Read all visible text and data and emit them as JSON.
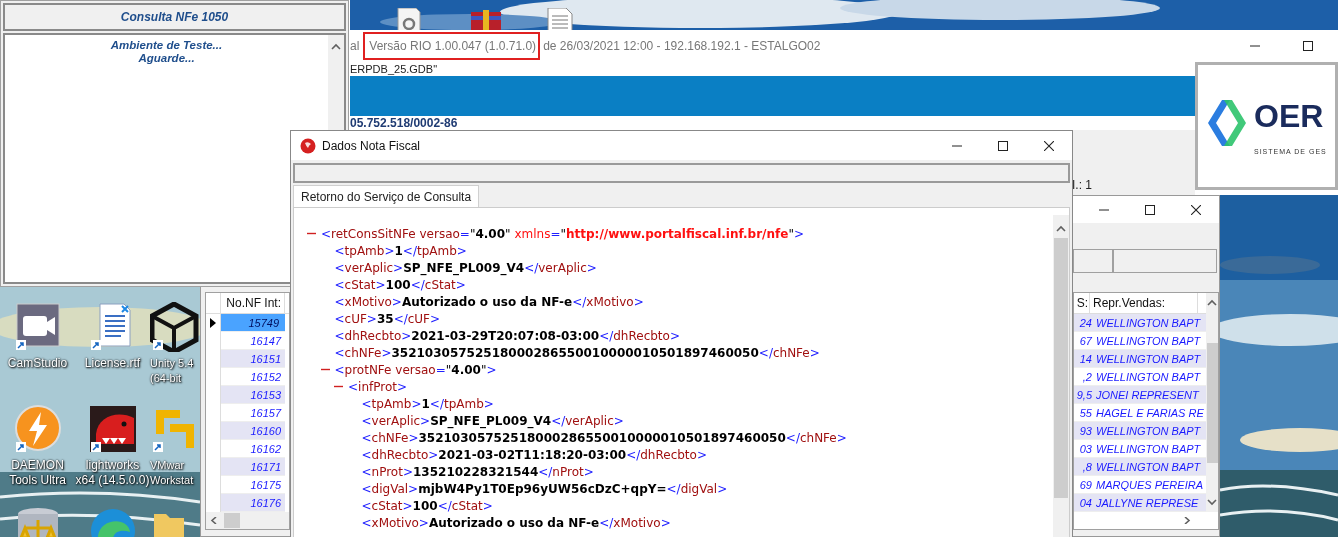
{
  "desktop": {
    "kind": "picture",
    "icons": [
      {
        "lines": [
          "CamStudio"
        ]
      },
      {
        "lines": [
          "License.rtf"
        ]
      },
      {
        "lines": [
          "Unity 5.4",
          "(64-bit"
        ]
      },
      {
        "lines": [
          "DAEMON",
          "Tools Ultra"
        ]
      },
      {
        "lines": [
          "lightworks",
          "x64 (14.5.0.0)"
        ]
      },
      {
        "lines": [
          "VMwar",
          "Workstat"
        ]
      }
    ]
  },
  "consulta_panel": {
    "title": "Consulta NFe 1050",
    "messages": [
      "Ambiente de Teste...",
      "Aguarde..."
    ]
  },
  "main_window": {
    "title_prefix": "al",
    "version": {
      "text": "Versão RIO 1.00.047 (1.0.71.0)",
      "highlighted": true
    },
    "title_rest": "de 26/03/2021 12:00 - 192.168.192.1 - ESTALGO02",
    "database": "ERPDB_25.GDB\"",
    "cnpj": "05.752.518/0002-86",
    "field_fragment": "I.: 1",
    "logo": {
      "text": "OER",
      "tagline": "SISTEMA DE GES"
    }
  },
  "list_window": {
    "columns": [
      "No.NF Int:",
      "S:",
      "Repr.Vendas:"
    ],
    "rows": [
      {
        "nf": "15749",
        "s": "24",
        "rep": "WELLINGTON BAPT",
        "selected": true
      },
      {
        "nf": "16147",
        "s": "67",
        "rep": "WELLINGTON BAPT",
        "selected": false
      },
      {
        "nf": "16151",
        "s": "14",
        "rep": "WELLINGTON BAPT",
        "selected": false
      },
      {
        "nf": "16152",
        "s": ",2",
        "rep": "WELLINGTON BAPT",
        "selected": false
      },
      {
        "nf": "16153",
        "s": "9,5",
        "rep": "JONEI REPRESENT",
        "selected": false
      },
      {
        "nf": "16157",
        "s": "55",
        "rep": "HAGEL E FARIAS RE",
        "selected": false
      },
      {
        "nf": "16160",
        "s": "93",
        "rep": "WELLINGTON BAPT",
        "selected": false
      },
      {
        "nf": "16162",
        "s": "03",
        "rep": "WELLINGTON BAPT",
        "selected": false
      },
      {
        "nf": "16171",
        "s": ",8",
        "rep": "WELLINGTON BAPT",
        "selected": false
      },
      {
        "nf": "16175",
        "s": "69",
        "rep": "MARQUES PEREIRA",
        "selected": false
      },
      {
        "nf": "16176",
        "s": "04",
        "rep": "JALLYNE REPRESE",
        "selected": false
      }
    ]
  },
  "dialog": {
    "title": "Dados Nota Fiscal",
    "tabs": [
      {
        "label": "Retorno do Serviço de Consulta",
        "selected": true
      }
    ],
    "xml": [
      {
        "tag_open": "<retConsSitNFe",
        "attributes": [
          {
            "kind": "attribute",
            "name": " versao=",
            "value": "\"4.00\""
          },
          {
            "kind": "namespace",
            "name": " xmlns=",
            "value": "\"http://www.portalfiscal.inf.br/nfe\""
          }
        ],
        "tag_end": ">",
        "expanded": true,
        "children": [
          {
            "tag_open": "<tpAmb>",
            "value": "1",
            "tag_close": "</tpAmb>"
          },
          {
            "tag_open": "<verAplic>",
            "value": "SP_NFE_PL009_V4",
            "tag_close": "</verAplic>"
          },
          {
            "tag_open": "<cStat>",
            "value": "100",
            "tag_close": "</cStat>"
          },
          {
            "tag_open": "<xMotivo>",
            "value": "Autorizado o uso da NF-e",
            "tag_close": "</xMotivo>"
          },
          {
            "tag_open": "<cUF>",
            "value": "35",
            "tag_close": "</cUF>"
          },
          {
            "tag_open": "<dhRecbto>",
            "value": "2021-03-29T20:07:08-03:00",
            "tag_close": "</dhRecbto>"
          },
          {
            "tag_open": "<chNFe>",
            "value": "35210305752518000286550010000010501897460050",
            "tag_close": "</chNFe>"
          },
          {
            "tag_open": "<protNFe",
            "attributes": [
              {
                "kind": "attribute",
                "name": " versao=",
                "value": "\"4.00\""
              }
            ],
            "tag_end": ">",
            "expanded": true,
            "children": [
              {
                "tag_open": "<infProt>",
                "expanded": true,
                "children": [
                  {
                    "tag_open": "<tpAmb>",
                    "value": "1",
                    "tag_close": "</tpAmb>"
                  },
                  {
                    "tag_open": "<verAplic>",
                    "value": "SP_NFE_PL009_V4",
                    "tag_close": "</verAplic>"
                  },
                  {
                    "tag_open": "<chNFe>",
                    "value": "35210305752518000286550010000010501897460050",
                    "tag_close": "</chNFe>"
                  },
                  {
                    "tag_open": "<dhRecbto>",
                    "value": "2021-03-02T11:18:20-03:00",
                    "tag_close": "</dhRecbto>"
                  },
                  {
                    "tag_open": "<nProt>",
                    "value": "135210228321544",
                    "tag_close": "</nProt>"
                  },
                  {
                    "tag_open": "<digVal>",
                    "value": "mjbW4Py1T0Ep96yUW56cDzC+qpY=",
                    "tag_close": "</digVal>"
                  },
                  {
                    "tag_open": "<cStat>",
                    "value": "100",
                    "tag_close": "</cStat>"
                  },
                  {
                    "tag_open": "<xMotivo>",
                    "value": "Autorizado o uso da NF-e",
                    "tag_close": "</xMotivo>"
                  }
                ]
              }
            ]
          }
        ]
      }
    ]
  }
}
